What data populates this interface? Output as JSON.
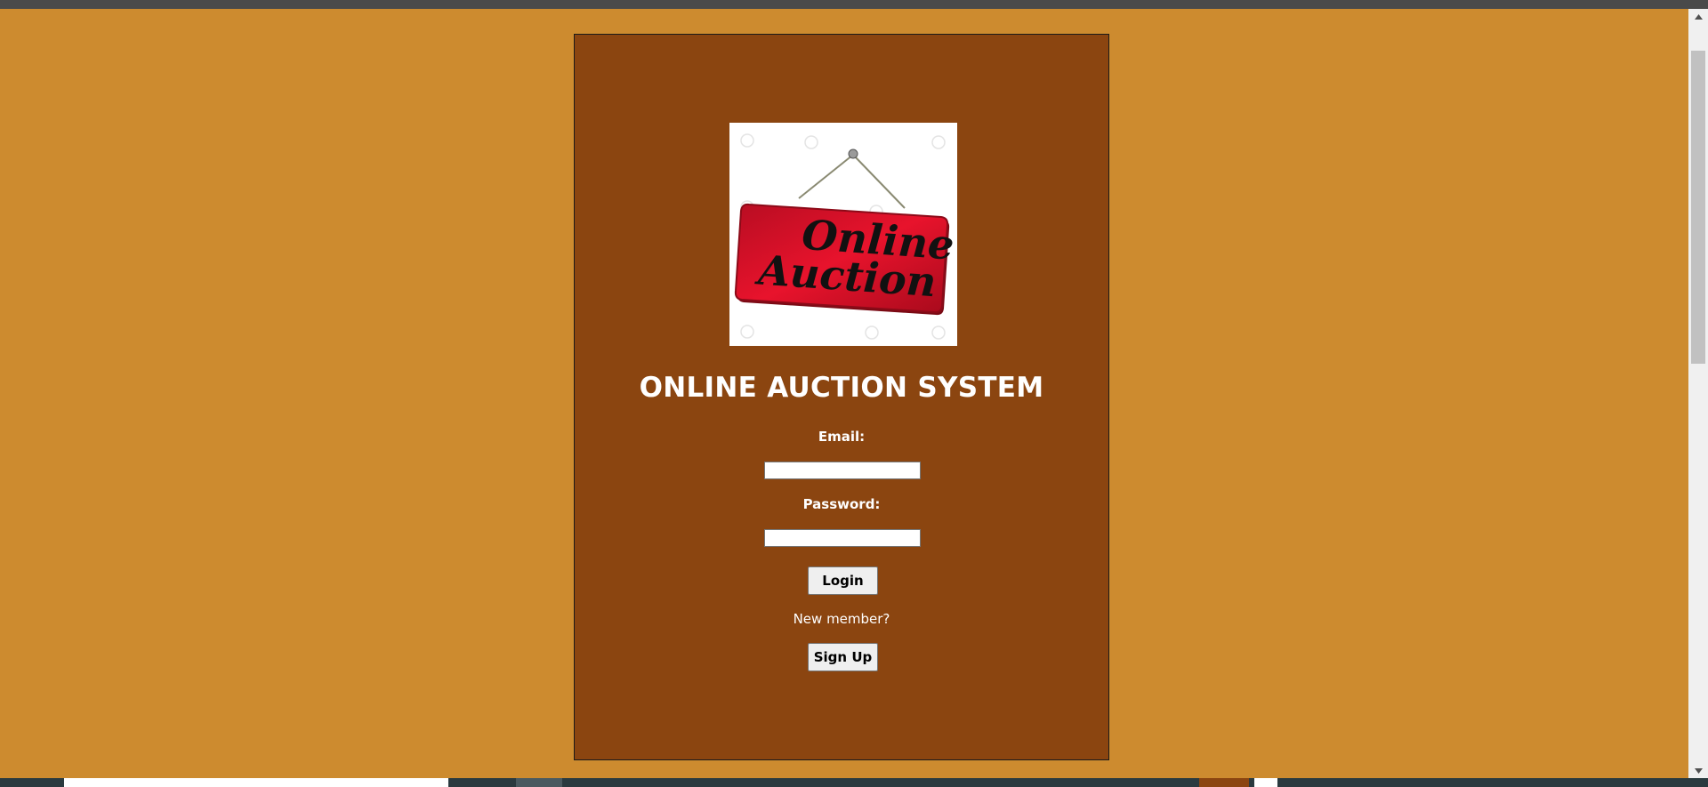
{
  "page": {
    "title": "ONLINE AUCTION SYSTEM",
    "logo_alt": "Online Auction"
  },
  "logo": {
    "sign_text_line1": "Online",
    "sign_text_line2": "Auction"
  },
  "form": {
    "email_label": "Email:",
    "email_value": "",
    "password_label": "Password:",
    "password_value": "",
    "login_label": "Login",
    "new_member_text": "New member?",
    "signup_label": "Sign Up"
  },
  "colors": {
    "page_background": "#cd8b2f",
    "panel_background": "#8b4510",
    "sign_red": "#c8102e",
    "text": "#ffffff"
  }
}
